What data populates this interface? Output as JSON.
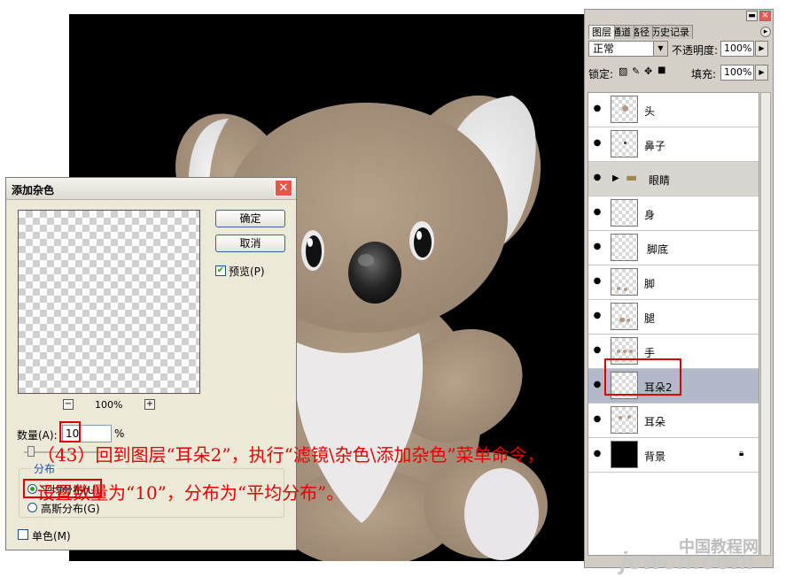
{
  "layers_panel": {
    "tabs": [
      "图层",
      "通道",
      "路径",
      "历史记录"
    ],
    "blend_mode": "正常",
    "opacity_label": "不透明度:",
    "opacity_value": "100%",
    "lock_label": "锁定:",
    "fill_label": "填充:",
    "fill_value": "100%",
    "layers": [
      {
        "name": "头"
      },
      {
        "name": "鼻子"
      },
      {
        "name": "眼睛"
      },
      {
        "name": "身"
      },
      {
        "name": "脚底"
      },
      {
        "name": "脚"
      },
      {
        "name": "腿"
      },
      {
        "name": "手"
      },
      {
        "name": "耳朵2"
      },
      {
        "name": "耳朵"
      },
      {
        "name": "背景"
      }
    ]
  },
  "dialog": {
    "title": "添加杂色",
    "ok_label": "确定",
    "cancel_label": "取消",
    "preview_label": "预览(P)",
    "zoom_level": "100%",
    "amount_label": "数量(A):",
    "amount_value": "10",
    "percent_sign": "%",
    "distribution_label": "分布",
    "uniform_label": "平均分布(U)",
    "gaussian_label": "高斯分布(G)",
    "mono_label": "单色(M)"
  },
  "annotation": {
    "line1": "（43）回到图层“耳朵2”，执行“滤镜\\杂色\\添加杂色”菜单命令，",
    "line2": "设置数量为“10”，分布为“平均分布”。"
  },
  "watermark": {
    "cn": "中国教程网",
    "url": "jcwcn.com"
  },
  "colors": {
    "annotation_red": "#e60000",
    "selected_layer": "#b3b9c9",
    "canvas_bg": "#000000",
    "fur": "#a6927c"
  }
}
